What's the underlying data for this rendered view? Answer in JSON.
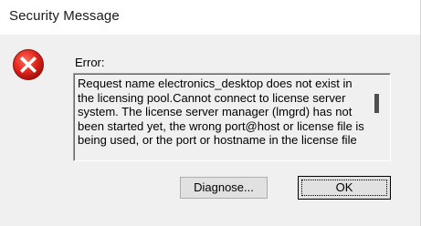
{
  "window": {
    "title": "Security Message"
  },
  "dialog": {
    "icon": "error-icon",
    "label": "Error:",
    "message": "Request name electronics_desktop does not exist in the licensing pool.Cannot connect to license server system. The license server manager (lmgrd) has not been started yet, the wrong port@host or license file is being used, or the port or hostname in the license file"
  },
  "buttons": {
    "diagnose_label": "Diagnose...",
    "ok_label": "OK"
  },
  "colors": {
    "error_red": "#e81123",
    "dialog_bg": "#f0f0f0",
    "titlebar_bg": "#ffffff"
  }
}
